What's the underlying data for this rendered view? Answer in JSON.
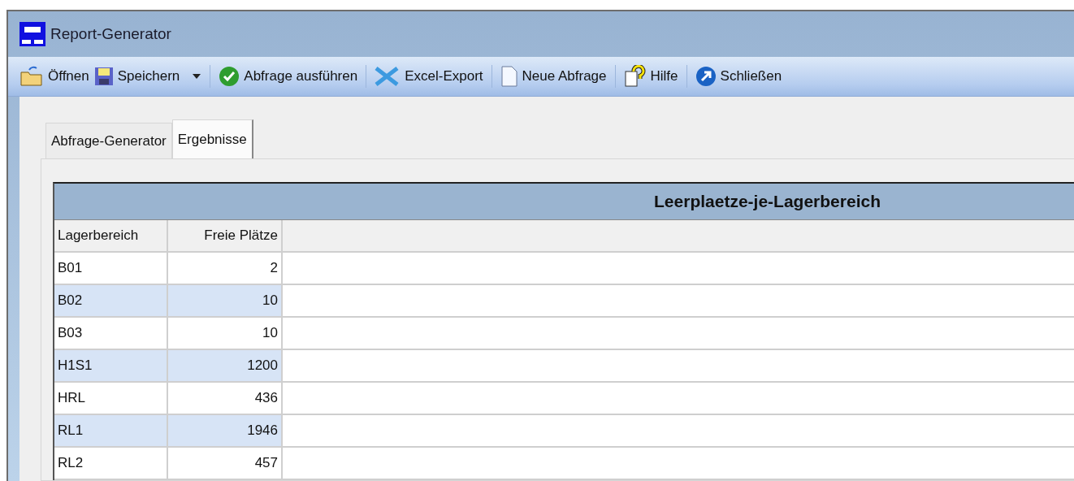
{
  "window": {
    "title": "Report-Generator"
  },
  "toolbar": {
    "groups": [
      [
        {
          "label": "Öffnen",
          "dropdown": false
        },
        {
          "label": "Speichern",
          "dropdown": true
        }
      ],
      [
        {
          "label": "Abfrage ausführen",
          "dropdown": false
        }
      ],
      [
        {
          "label": "Excel-Export",
          "dropdown": false
        }
      ],
      [
        {
          "label": "Neue Abfrage",
          "dropdown": false
        }
      ],
      [
        {
          "label": "Hilfe",
          "dropdown": false
        }
      ],
      [
        {
          "label": "Schließen",
          "dropdown": false
        }
      ]
    ]
  },
  "tabs": [
    {
      "label": "Abfrage-Generator",
      "selected": false
    },
    {
      "label": "Ergebnisse",
      "selected": true
    }
  ],
  "grid": {
    "title": "Leerplaetze-je-Lagerbereich",
    "columns": [
      "Lagerbereich",
      "Freie Plätze"
    ],
    "rows": [
      [
        "B01",
        "2"
      ],
      [
        "B02",
        "10"
      ],
      [
        "B03",
        "10"
      ],
      [
        "H1S1",
        "1200"
      ],
      [
        "HRL",
        "436"
      ],
      [
        "RL1",
        "1946"
      ],
      [
        "RL2",
        "457"
      ]
    ]
  }
}
